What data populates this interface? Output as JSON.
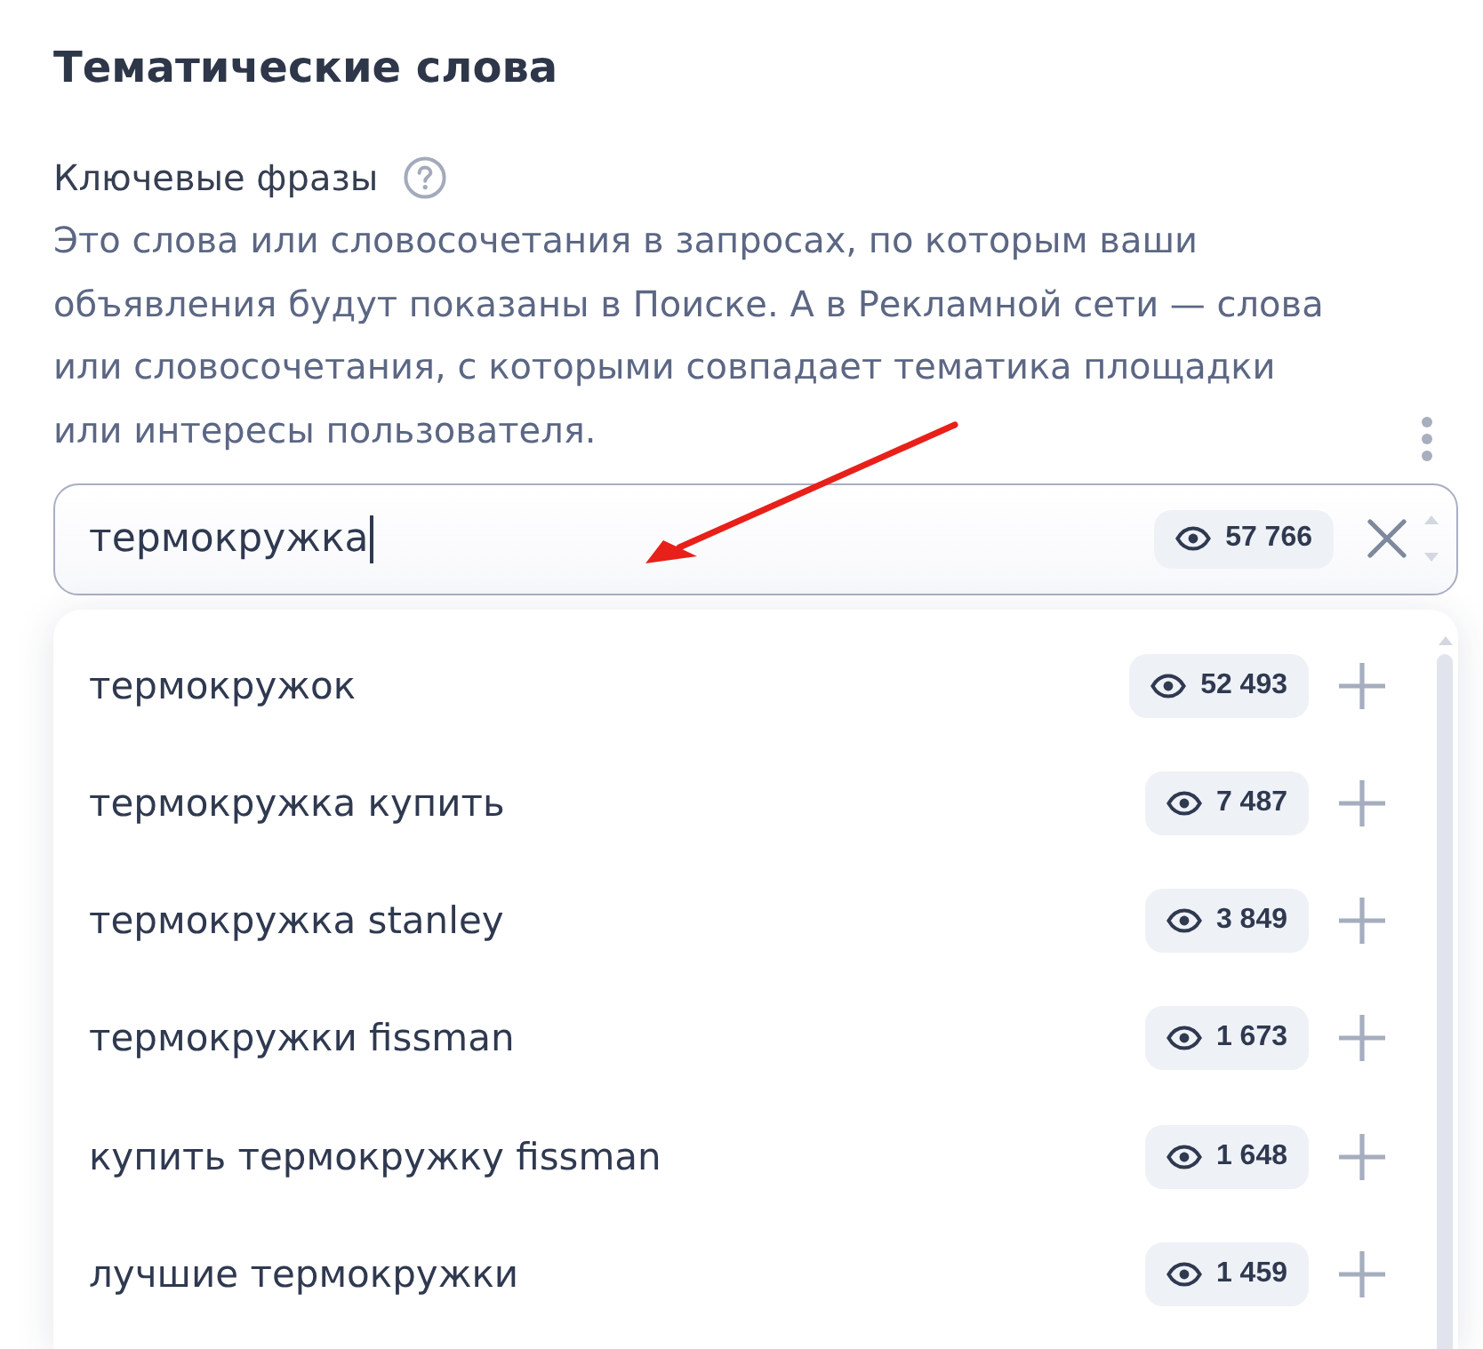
{
  "section": {
    "title": "Тематические слова"
  },
  "keyword_phrases": {
    "label": "Ключевые фразы",
    "description": "Это слова или словосочетания в запросах, по которым ваши объявления будут показаны в Поиске. А в Рекламной сети — слова или словосочетания, с которыми совпадает тематика площадки или интересы пользователя."
  },
  "input": {
    "value": "термокружка",
    "impressions": "57 766"
  },
  "suggestions": [
    {
      "phrase": "термокружок",
      "impressions": "52 493"
    },
    {
      "phrase": "термокружка купить",
      "impressions": "7 487"
    },
    {
      "phrase": "термокружка stanley",
      "impressions": "3 849"
    },
    {
      "phrase": "термокружки fissman",
      "impressions": "1 673"
    },
    {
      "phrase": "купить термокружку fissman",
      "impressions": "1 648"
    },
    {
      "phrase": "лучшие термокружки",
      "impressions": "1 459"
    }
  ]
}
